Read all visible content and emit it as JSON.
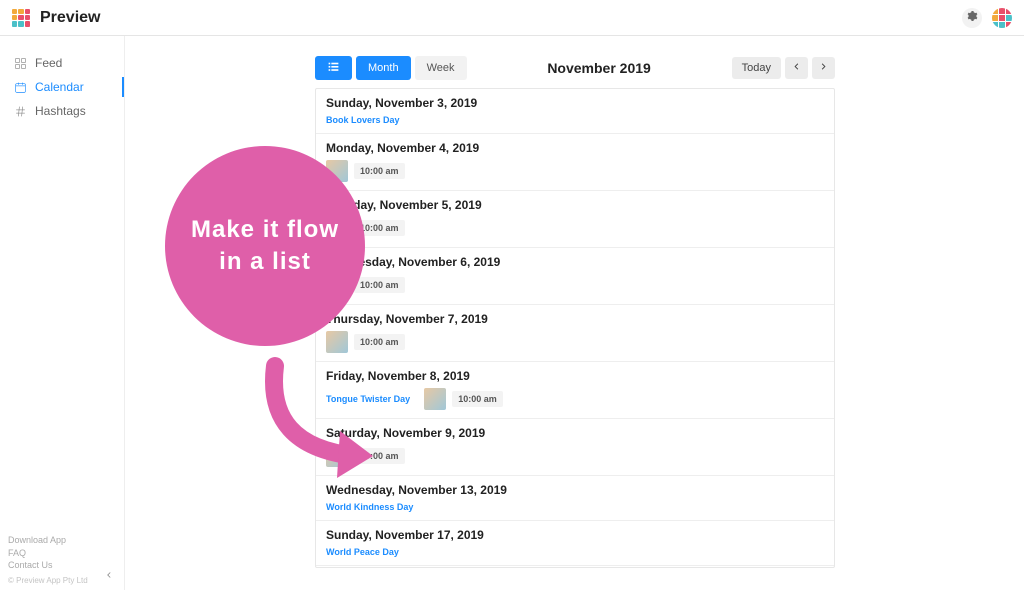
{
  "app": {
    "name": "Preview"
  },
  "sidebar": {
    "items": [
      {
        "id": "feed",
        "label": "Feed"
      },
      {
        "id": "calendar",
        "label": "Calendar"
      },
      {
        "id": "hashtags",
        "label": "Hashtags"
      }
    ],
    "footer": {
      "download": "Download App",
      "faq": "FAQ",
      "contact": "Contact Us",
      "copyright": "© Preview App Pty Ltd"
    }
  },
  "annotation": {
    "bubble": "Make it flow in a list"
  },
  "calendar": {
    "title": "November 2019",
    "views": {
      "list": "List",
      "month": "Month",
      "week": "Week"
    },
    "today": "Today",
    "days": [
      {
        "header": "Sunday, November 3, 2019",
        "special": "Book Lovers Day"
      },
      {
        "header": "Monday, November 4, 2019",
        "post_time": "10:00 am"
      },
      {
        "header": "Tuesday, November 5, 2019",
        "post_time": "10:00 am"
      },
      {
        "header": "Wednesday, November 6, 2019",
        "post_time": "10:00 am"
      },
      {
        "header": "Thursday, November 7, 2019",
        "post_time": "10:00 am"
      },
      {
        "header": "Friday, November 8, 2019",
        "special": "Tongue Twister Day",
        "post_time": "10:00 am"
      },
      {
        "header": "Saturday, November 9, 2019",
        "post_time": "10:00 am"
      },
      {
        "header": "Wednesday, November 13, 2019",
        "special": "World Kindness Day"
      },
      {
        "header": "Sunday, November 17, 2019",
        "special": "World Peace Day"
      }
    ]
  },
  "colors": {
    "accent": "#1b8cff",
    "pink": "#df5fa9"
  }
}
